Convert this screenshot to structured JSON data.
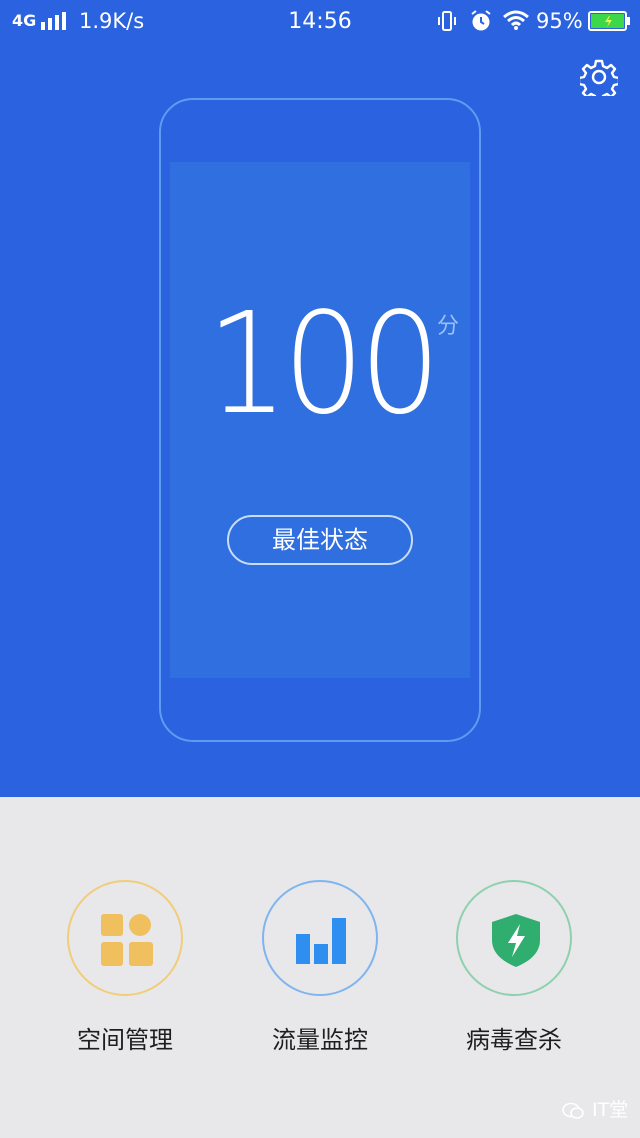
{
  "status_bar": {
    "network": "4G",
    "speed": "1.9K/s",
    "time": "14:56",
    "battery_percent": "95%"
  },
  "colors": {
    "header_bg": "#2a62df",
    "space_accent": "#f0c05e",
    "traffic_accent": "#2f8ff0",
    "virus_accent": "#2fae6f"
  },
  "score": {
    "value": "100",
    "unit": "分",
    "status_label": "最佳状态"
  },
  "tools": [
    {
      "label": "空间管理",
      "icon": "blocks-icon"
    },
    {
      "label": "流量监控",
      "icon": "bar-chart-icon"
    },
    {
      "label": "病毒查杀",
      "icon": "shield-bolt-icon"
    }
  ],
  "watermark": {
    "text": "IT堂"
  }
}
